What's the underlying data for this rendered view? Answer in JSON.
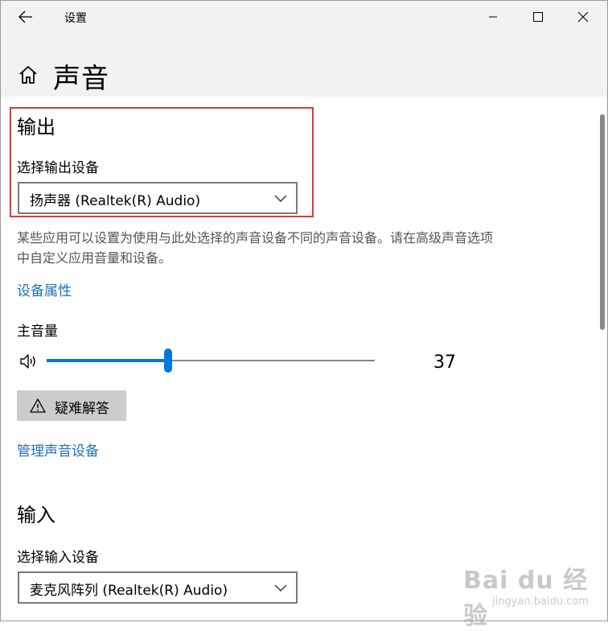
{
  "window": {
    "app_title": "设置"
  },
  "page": {
    "title": "声音"
  },
  "output": {
    "heading": "输出",
    "select_label": "选择输出设备",
    "device": "扬声器 (Realtek(R) Audio)",
    "description": "某些应用可以设置为使用与此处选择的声音设备不同的声音设备。请在高级声音选项中自定义应用音量和设备。",
    "properties_link": "设备属性",
    "volume_label": "主音量",
    "volume": 37,
    "volume_text": "37",
    "troubleshoot_label": "疑难解答",
    "manage_link": "管理声音设备"
  },
  "input": {
    "heading": "输入",
    "select_label": "选择输入设备",
    "device": "麦克风阵列 (Realtek(R) Audio)"
  },
  "watermark": {
    "main": "Bai du 经验",
    "sub": "jingyan.baidu.com"
  },
  "colors": {
    "accent": "#0078d7",
    "link": "#1f6fb5",
    "highlight": "#e0393e"
  },
  "icons": [
    "back-arrow-icon",
    "minimize-icon",
    "maximize-icon",
    "close-icon",
    "home-icon",
    "chevron-down-icon",
    "speaker-icon",
    "warning-icon"
  ]
}
